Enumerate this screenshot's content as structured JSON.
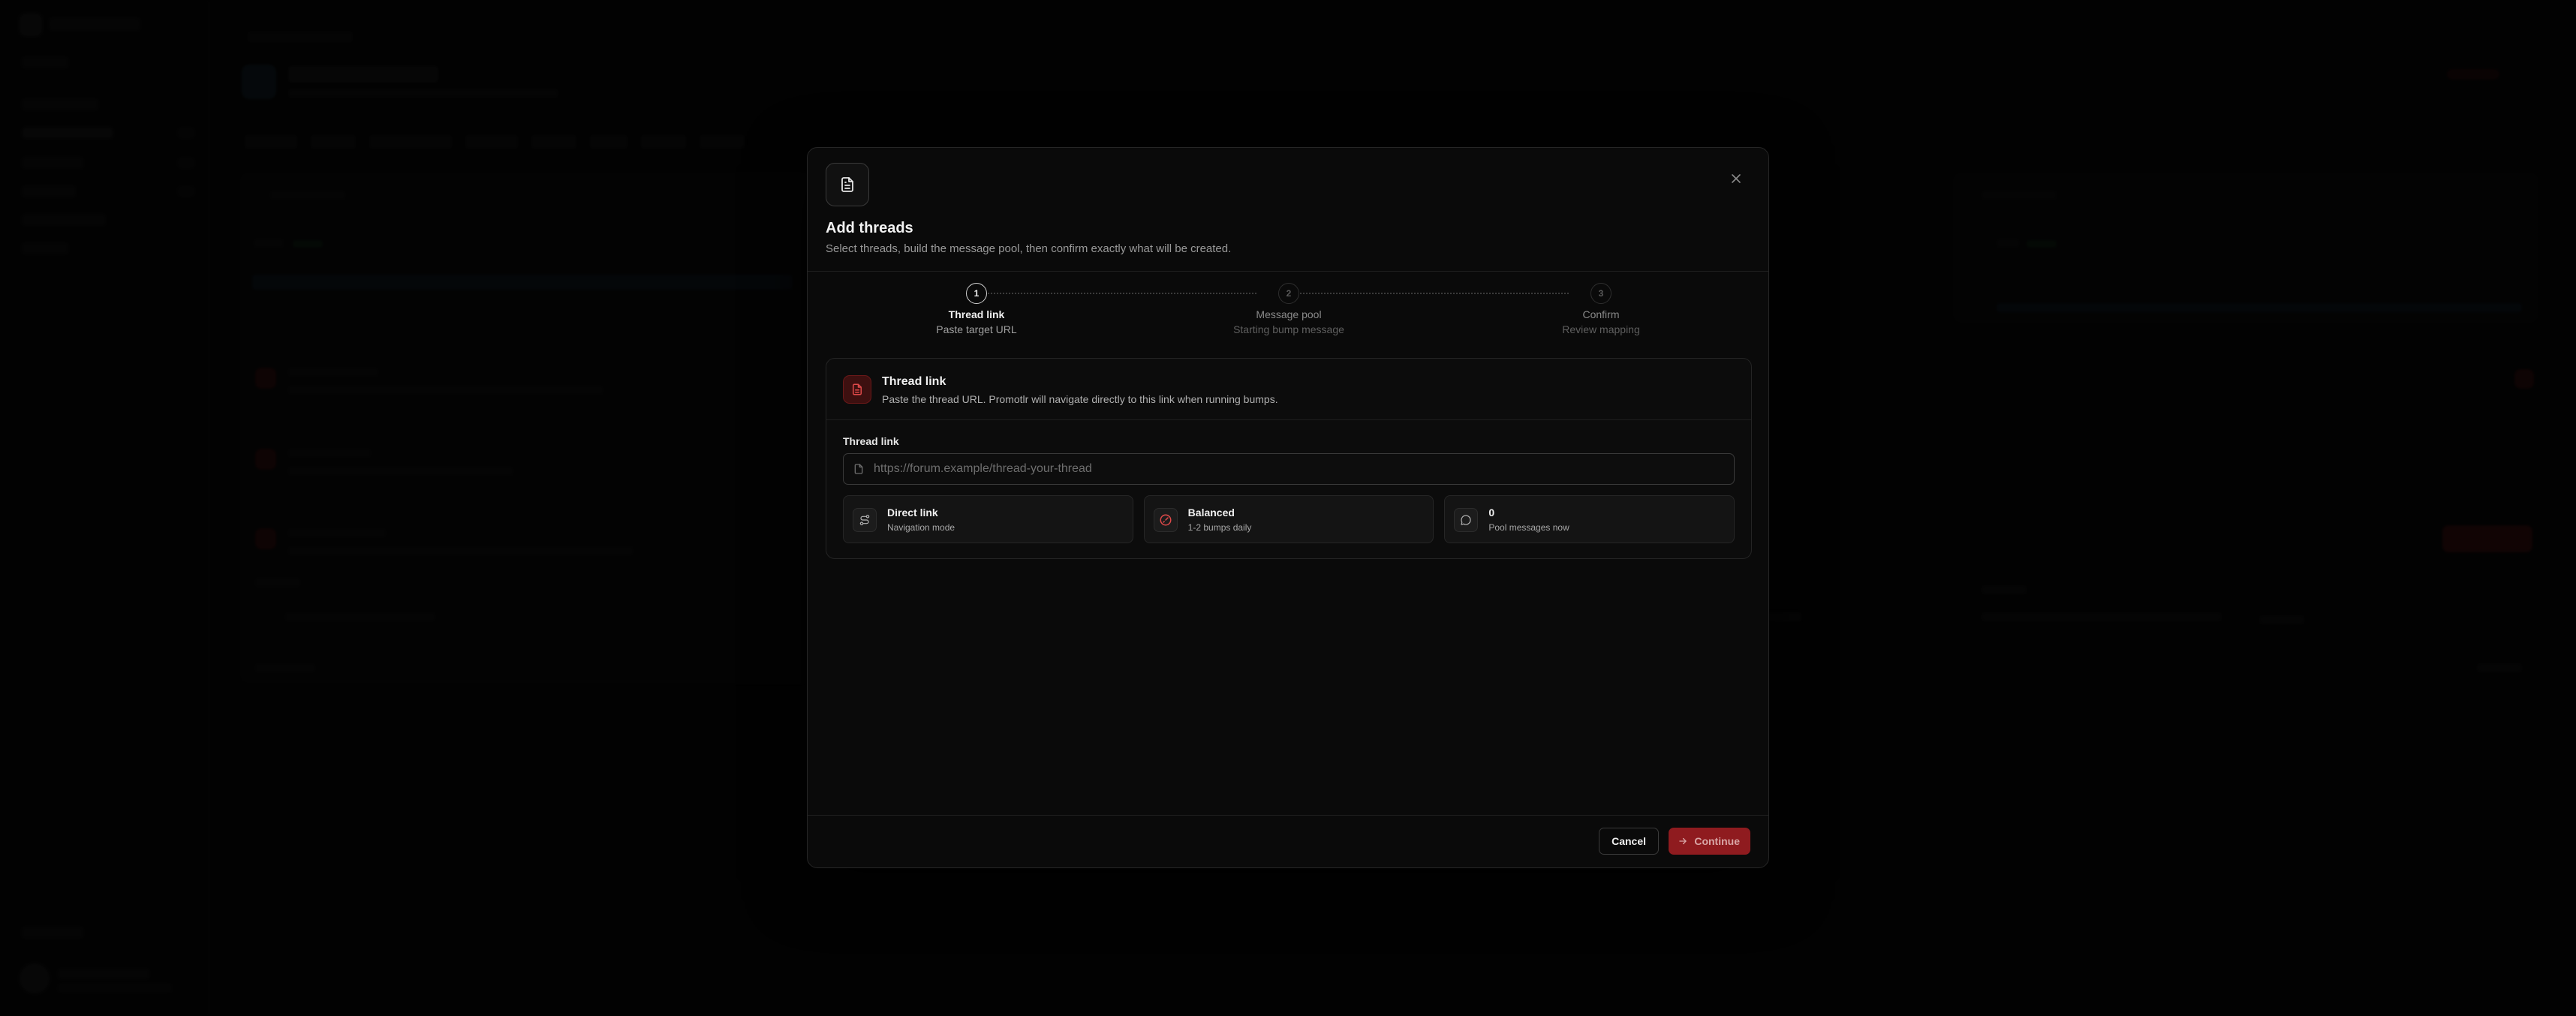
{
  "modal": {
    "title": "Add threads",
    "description": "Select threads, build the message pool, then confirm exactly what will be created.",
    "icon": "document-icon",
    "close_icon": "close-icon"
  },
  "stepper": {
    "steps": [
      {
        "number": "1",
        "label": "Thread link",
        "sublabel": "Paste target URL",
        "state": "active"
      },
      {
        "number": "2",
        "label": "Message pool",
        "sublabel": "Starting bump message",
        "state": "inactive"
      },
      {
        "number": "3",
        "label": "Confirm",
        "sublabel": "Review mapping",
        "state": "inactive"
      }
    ]
  },
  "card": {
    "title": "Thread link",
    "description": "Paste the thread URL. Promotlr will navigate directly to this link when running bumps.",
    "icon": "document-icon",
    "field_label": "Thread link",
    "input_value": "",
    "input_placeholder": "https://forum.example/thread-your-thread",
    "stats": [
      {
        "title": "Direct link",
        "sub": "Navigation mode",
        "icon": "route-icon"
      },
      {
        "title": "Balanced",
        "sub": "1-2 bumps daily",
        "icon": "gauge-icon"
      },
      {
        "title": "0",
        "sub": "Pool messages now",
        "icon": "message-icon"
      }
    ]
  },
  "footer": {
    "cancel_label": "Cancel",
    "continue_label": "Continue"
  },
  "colors": {
    "accent": "#8f1b1f",
    "accent_icon": "#e04a4a",
    "background": "#050505",
    "modal_background": "#0a0a0a"
  }
}
